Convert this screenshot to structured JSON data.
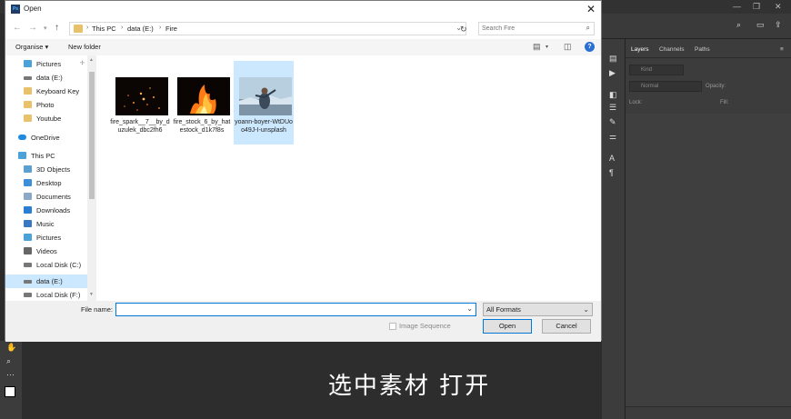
{
  "dialog": {
    "title": "Open",
    "app_icon_text": "Ps",
    "address": {
      "crumbs": [
        "This PC",
        "data (E:)",
        "Fire"
      ]
    },
    "search_placeholder": "Search Fire",
    "toolbar": {
      "organise": "Organise ▾",
      "new_folder": "New folder"
    },
    "nav_items": [
      {
        "label": "Pictures",
        "icon": "pictures-icon"
      },
      {
        "label": "data (E:)",
        "icon": "drive-icon"
      },
      {
        "label": "Keyboard Key",
        "icon": "folder-icon"
      },
      {
        "label": "Photo",
        "icon": "folder-icon"
      },
      {
        "label": "Youtube",
        "icon": "folder-icon"
      },
      {
        "label": "OneDrive",
        "icon": "onedrive-icon"
      },
      {
        "label": "This PC",
        "icon": "pc-icon"
      },
      {
        "label": "3D Objects",
        "icon": "3d-objects-icon"
      },
      {
        "label": "Desktop",
        "icon": "desktop-icon"
      },
      {
        "label": "Documents",
        "icon": "documents-icon"
      },
      {
        "label": "Downloads",
        "icon": "downloads-icon"
      },
      {
        "label": "Music",
        "icon": "music-icon"
      },
      {
        "label": "Pictures",
        "icon": "pictures-icon"
      },
      {
        "label": "Videos",
        "icon": "videos-icon"
      },
      {
        "label": "Local Disk (C:)",
        "icon": "disk-icon"
      },
      {
        "label": "data (E:)",
        "icon": "drive-icon"
      },
      {
        "label": "Local Disk (F:)",
        "icon": "disk-icon"
      }
    ],
    "files": [
      {
        "name": "fire_spark__7__by_duzulek_dbc2fh6"
      },
      {
        "name": "fire_stock_6_by_hatestock_d1k7f8s"
      },
      {
        "name": "yoann-boyer-WtDUoo49J-I-unsplash"
      }
    ],
    "file_name_label": "File name:",
    "file_name_value": "",
    "format_value": "All Formats",
    "image_sequence_label": "Image Sequence",
    "open_label": "Open",
    "cancel_label": "Cancel"
  },
  "photoshop": {
    "tabs": [
      "Layers",
      "Channels",
      "Paths"
    ],
    "kind_label": "Kind",
    "blend_mode": "Normal",
    "opacity_label": "Opacity:",
    "lock_label": "Lock:",
    "fill_label": "Fill:"
  },
  "subtitle": "选中素材  打开"
}
